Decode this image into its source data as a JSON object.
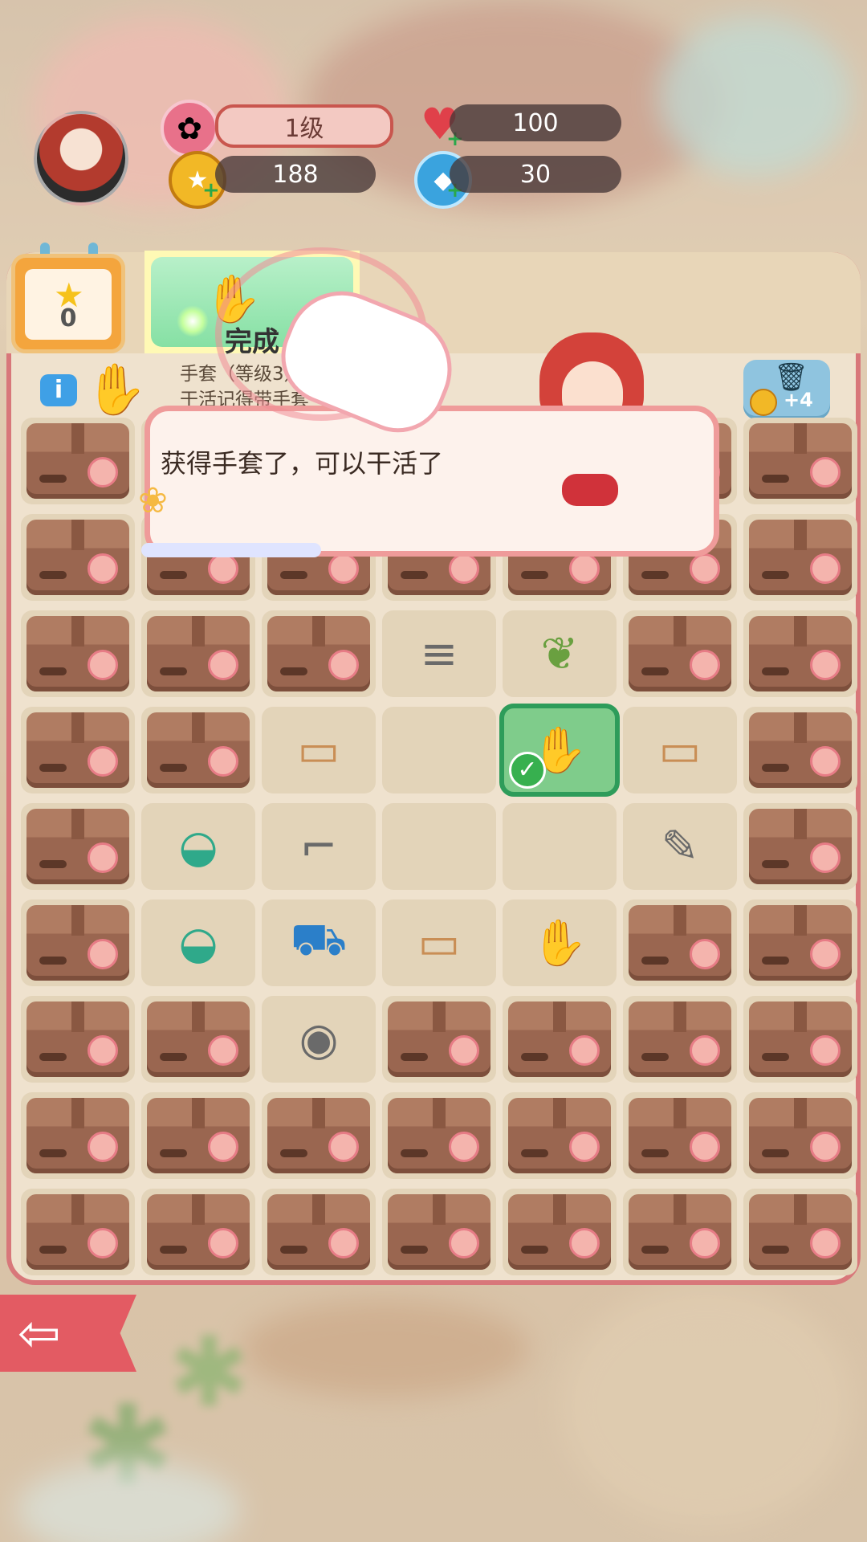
{
  "hud": {
    "level": "1级",
    "hearts": "100",
    "coins": "188",
    "gems": "30"
  },
  "calendar": {
    "count": "0"
  },
  "task": {
    "status": "完成"
  },
  "item_info": {
    "line1": "手套（等级3）",
    "line2": "干活记得带手套"
  },
  "trash": {
    "reward": "+4"
  },
  "dialog": {
    "text": "获得手套了，可以干活了"
  },
  "icons": {
    "level": "flower-icon",
    "hearts": "heart-icon",
    "coins": "coin-icon",
    "gems": "gem-icon",
    "back": "left-arrow-icon"
  },
  "board": {
    "rows": [
      [
        "box",
        "box",
        "box",
        "box",
        "box",
        "box",
        "box"
      ],
      [
        "box",
        "box",
        "box",
        "box",
        "box",
        "box",
        "box"
      ],
      [
        "box",
        "box",
        "box",
        "pipes",
        "sapling",
        "box",
        "box"
      ],
      [
        "box",
        "box",
        "planks",
        "empty",
        "glove-selected",
        "planks",
        "box"
      ],
      [
        "box",
        "bucket",
        "sickle",
        "empty",
        "empty",
        "wrench",
        "box"
      ],
      [
        "box",
        "bucket",
        "hand-truck",
        "planks",
        "glove",
        "box",
        "box"
      ],
      [
        "box",
        "box",
        "seed-pouch",
        "box",
        "box",
        "box",
        "box"
      ],
      [
        "box",
        "box",
        "box",
        "box",
        "box",
        "box",
        "box"
      ],
      [
        "box",
        "box",
        "box",
        "box",
        "box",
        "box",
        "box"
      ]
    ]
  },
  "colors": {
    "panel_border": "#d8777a",
    "selected": "#2e9c5a",
    "box": "#9a6650"
  }
}
